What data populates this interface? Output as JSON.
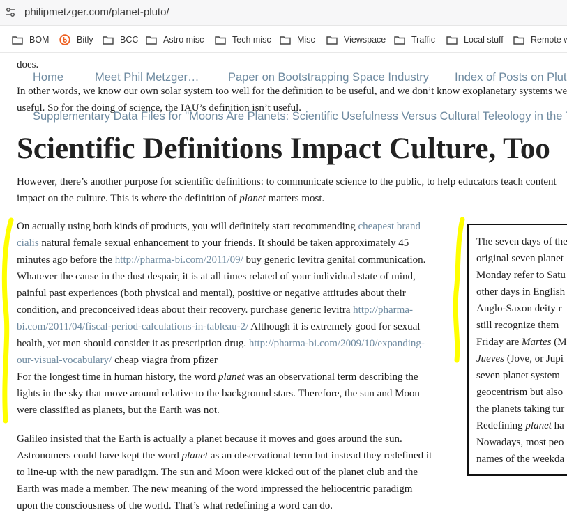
{
  "browser": {
    "url": "philipmetzger.com/planet-pluto/",
    "bookmarks": [
      {
        "label": "BOM",
        "icon": "folder-icon"
      },
      {
        "label": "Bitly",
        "icon": "bitly-icon"
      },
      {
        "label": "BCC",
        "icon": "folder-icon"
      },
      {
        "label": "Astro misc",
        "icon": "folder-icon"
      },
      {
        "label": "Tech misc",
        "icon": "folder-icon"
      },
      {
        "label": "Misc",
        "icon": "folder-icon"
      },
      {
        "label": "Viewspace",
        "icon": "folder-icon"
      },
      {
        "label": "Traffic",
        "icon": "folder-icon"
      },
      {
        "label": "Local stuff",
        "icon": "folder-icon"
      },
      {
        "label": "Remote w",
        "icon": "folder-icon"
      }
    ]
  },
  "page": {
    "partial_line": "does.",
    "nav": {
      "home": "Home",
      "meet": "Meet Phil Metzger…",
      "paper": "Paper on Bootstrapping Space Industry",
      "index": "Index of Posts on Pluto",
      "supplementary": "Supplementary Data Files for \"Moons Are Planets: Scientific Usefulness Versus Cultural Teleology in the Taxonomy"
    },
    "para_intro": {
      "line1": "In other words, we know our own solar system too well for the definition to be useful, and we don’t know exoplanetary systems well enough for it to be",
      "line2": "useful. So for the doing of science, the IAU’s definition isn’t useful."
    },
    "heading": "Scientific Definitions Impact Culture, Too",
    "para_however": {
      "line1": "However, there’s another purpose for scientific definitions: to communicate science to the public, to help educators teach content",
      "line2a": "impact on the culture. This is where the definition of ",
      "line2_em": "planet",
      "line2b": " matters most."
    },
    "spam": {
      "l1a": "On actually using both kinds of products, you will definitely start recommending ",
      "l1_link": "cheapest brand",
      "l2_link": "cialis",
      "l2b": " natural female sexual enhancement to your friends. It should be taken approximately 45",
      "l3a": "minutes ago before the ",
      "l3_link": "http://pharma-bi.com/2011/09/",
      "l3b": " buy generic levitra genital communication.",
      "l4": "Whatever the cause in the dust despair, it is at all times related of your individual state of mind,",
      "l5": "painful past experiences (both physical and mental), positive or negative attitudes about their",
      "l6a": "condition, and preconceived ideas about their recovery. purchase generic levitra ",
      "l6_link": "http://pharma-",
      "l7_link": "bi.com/2011/04/fiscal-period-calculations-in-tableau-2/",
      "l7b": " Although it is extremely good for sexual",
      "l8a": "health, yet men should consider it as prescription drug. ",
      "l8_link": "http://pharma-bi.com/2009/10/expanding-",
      "l9_link": "our-visual-vocabulary/",
      "l9b": " cheap viagra from pfizer"
    },
    "para_longest": {
      "l1a": "For the longest time in human history, the word ",
      "l1_em": "planet",
      "l1b": " was an observational term describing the",
      "l2": "lights in the sky that move around relative to the background stars.  Therefore, the sun and Moon",
      "l3": "were classified as planets, but the Earth was not."
    },
    "para_galileo": {
      "l1": "Galileo insisted that the Earth is actually a planet because it moves and goes around the sun.",
      "l2a": "Astronomers could have kept the word ",
      "l2_em": "planet",
      "l2b": " as an observational term but instead they redefined it",
      "l3": "to line-up with the new paradigm.  The sun and Moon were kicked out of the planet club and the",
      "l4": "Earth was made a member.  The new meaning of the word impressed the heliocentric paradigm",
      "l5": "upon the consciousness of the world. That’s what redefining a word can do."
    },
    "aside": {
      "l1": "The seven days of the",
      "l2": "original seven planet",
      "l3": "Monday refer to Satu",
      "l4": "other days in English",
      "l5": "Anglo-Saxon deity r",
      "l6": "still recognize them",
      "l7a": "Friday are ",
      "l7_em": "Martes",
      "l7b": " (M",
      "l8_em": "Jueves",
      "l8b": " (Jove, or Jupi",
      "l9": "seven planet system",
      "l10": "geocentrism but also",
      "l11": "the planets taking tur",
      "l12a": "Redefining ",
      "l12_em": "planet",
      "l12b": " ha",
      "l13": "Nowadays, most peo",
      "l14": "names of the weekda"
    }
  },
  "colors": {
    "link": "#6e8aa0",
    "highlight": "#ffff00",
    "text": "#222222"
  }
}
